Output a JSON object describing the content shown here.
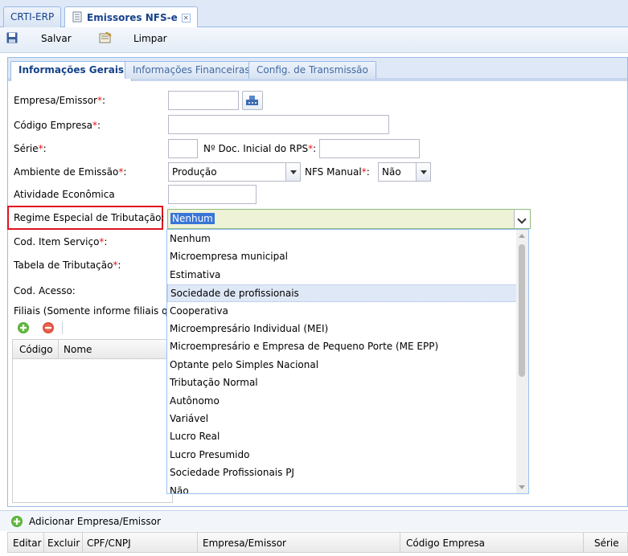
{
  "top_tabs": [
    {
      "label": "CRTI-ERP"
    },
    {
      "label": "Emissores NFS-e"
    }
  ],
  "toolbar": {
    "save_label": "Salvar",
    "clear_label": "Limpar"
  },
  "inner_tabs": [
    {
      "label": "Informações Gerais"
    },
    {
      "label": "Informações Financeiras"
    },
    {
      "label": "Config. de Transmissão"
    }
  ],
  "form": {
    "empresa_label": "Empresa/Emissor",
    "codigo_empresa_label": "Código Empresa",
    "serie_label": "Série",
    "num_doc_label": "Nº Doc. Inicial do RPS",
    "ambiente_label": "Ambiente de Emissão",
    "ambiente_value": "Produção",
    "nfs_manual_label": "NFS Manual",
    "nfs_manual_value": "Não",
    "atividade_label": "Atividade Econômica",
    "regime_label": "Regime Especial de Tributação:",
    "regime_value": "Nenhum",
    "cod_item_label": "Cod. Item Serviço",
    "tabela_label": "Tabela de Tributação",
    "cod_acesso_label": "Cod. Acesso:",
    "filiais_label": "Filiais (Somente informe filiais qu",
    "required_mark": "*",
    "colon": ":"
  },
  "dropdown": {
    "options": [
      "Nenhum",
      "Microempresa municipal",
      "Estimativa",
      "Sociedade de profissionais",
      "Cooperativa",
      "Microempresário Individual (MEI)",
      "Microempresário e Empresa de Pequeno Porte (ME EPP)",
      "Optante pelo Simples Nacional",
      "Tributação Normal",
      "Autônomo",
      "Variável",
      "Lucro Real",
      "Lucro Presumido",
      "Sociedade Profissionais PJ",
      "Não"
    ],
    "highlighted_index": 3
  },
  "filiais_grid": {
    "columns": [
      "Código",
      "Nome"
    ]
  },
  "bottom": {
    "add_label": "Adicionar Empresa/Emissor",
    "columns": [
      "Editar",
      "Excluir",
      "CPF/CNPJ",
      "Empresa/Emissor",
      "Código Empresa",
      "Série"
    ]
  },
  "colors": {
    "accent": "#15428b",
    "required": "#e11111",
    "highlight_border": "#e0141e",
    "selection": "#3875d7"
  }
}
